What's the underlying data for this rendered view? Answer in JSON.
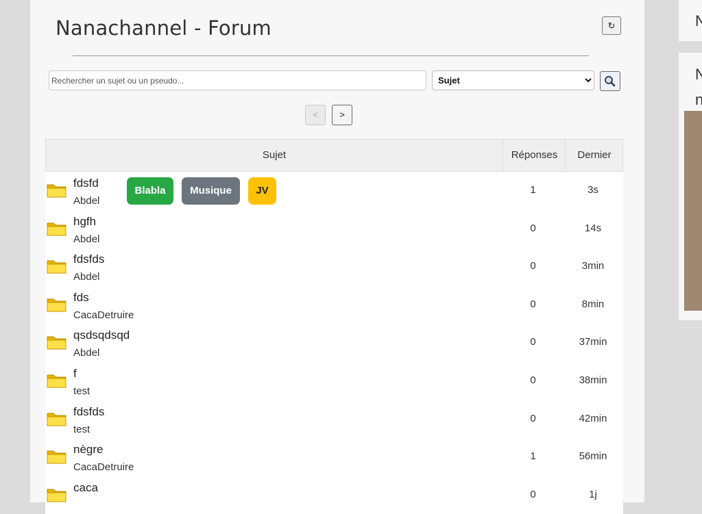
{
  "header": {
    "title": "Nanachannel - Forum",
    "refresh_icon": "↻"
  },
  "search": {
    "placeholder": "Rechercher un sujet ou un pseudo...",
    "filter_selected": "Sujet",
    "filter_options": [
      "Sujet"
    ]
  },
  "pagination": {
    "prev": "<",
    "next": ">"
  },
  "table": {
    "headers": {
      "subject": "Sujet",
      "replies": "Réponses",
      "last": "Dernier"
    },
    "rows": [
      {
        "title": "fdsfd",
        "author": "Abdel",
        "replies": "1",
        "last": "3s",
        "tags": [
          "Blabla",
          "Musique",
          "JV"
        ]
      },
      {
        "title": "hgfh",
        "author": "Abdel",
        "replies": "0",
        "last": "14s"
      },
      {
        "title": "fdsfds",
        "author": "Abdel",
        "replies": "0",
        "last": "3min"
      },
      {
        "title": "fds",
        "author": "CacaDetruire",
        "replies": "0",
        "last": "8min"
      },
      {
        "title": "qsdsqdsqd",
        "author": "Abdel",
        "replies": "0",
        "last": "37min"
      },
      {
        "title": "f",
        "author": "test",
        "replies": "0",
        "last": "38min"
      },
      {
        "title": "fdsfds",
        "author": "test",
        "replies": "0",
        "last": "42min"
      },
      {
        "title": "nègre",
        "author": "CacaDetruire",
        "replies": "1",
        "last": "56min"
      },
      {
        "title": "caca",
        "author": "",
        "replies": "0",
        "last": "1j"
      }
    ]
  },
  "tag_colors": {
    "Blabla": "#28a745",
    "Musique": "#6c757d",
    "JV": "#ffc107"
  },
  "sidebar": {
    "top_char": "N",
    "mid_char1": "N",
    "mid_char2": "n"
  }
}
